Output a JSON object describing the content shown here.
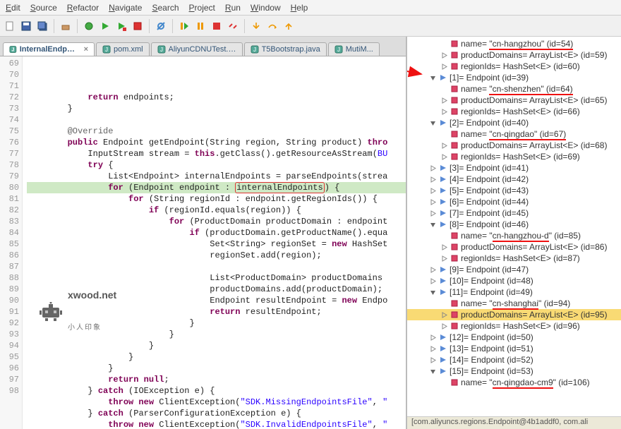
{
  "menu": {
    "items": [
      "Edit",
      "Source",
      "Refactor",
      "Navigate",
      "Search",
      "Project",
      "Run",
      "Window",
      "Help"
    ]
  },
  "tabs": [
    {
      "label": "InternalEndpoin...",
      "active": true
    },
    {
      "label": "pom.xml",
      "active": false
    },
    {
      "label": "AliyunCDNUTest.j...",
      "active": false
    },
    {
      "label": "T5Bootstrap.java",
      "active": false
    },
    {
      "label": "MutiM...",
      "active": false
    }
  ],
  "lines": [
    {
      "n": 69,
      "html": "            <span class='kw'>return</span> endpoints;"
    },
    {
      "n": 70,
      "html": "        }"
    },
    {
      "n": 71,
      "html": ""
    },
    {
      "n": 72,
      "html": "        <span class='ann'>@Override</span>"
    },
    {
      "n": 73,
      "html": "        <span class='kw'>public</span> Endpoint getEndpoint(String region, String product) <span class='kw'>thro</span>"
    },
    {
      "n": 74,
      "html": "            InputStream stream = <span class='kw'>this</span>.getClass().getResourceAsStream(<span class='str'>BU</span>"
    },
    {
      "n": 75,
      "html": "            <span class='kw'>try</span> {"
    },
    {
      "n": 76,
      "html": "                List&lt;Endpoint&gt; internalEndpoints = parseEndpoints(strea"
    },
    {
      "n": 77,
      "html": "<span class='hl-green'>                <span class='kw'>for</span> (Endpoint endpoint : <span class='box-red'>internalEndpoints</span>) {                </span>"
    },
    {
      "n": 78,
      "html": "                    <span class='kw'>for</span> (String regionId : endpoint.getRegionIds()) {"
    },
    {
      "n": 79,
      "html": "                        <span class='kw'>if</span> (regionId.equals(region)) {"
    },
    {
      "n": 80,
      "html": "                            <span class='kw'>for</span> (ProductDomain productDomain : endpoint"
    },
    {
      "n": 81,
      "html": "                                <span class='kw'>if</span> (productDomain.getProductName().equa"
    },
    {
      "n": 82,
      "html": "                                    Set&lt;String&gt; regionSet = <span class='kw'>new</span> HashSet"
    },
    {
      "n": 83,
      "html": "                                    regionSet.add(region);"
    },
    {
      "n": 84,
      "html": ""
    },
    {
      "n": 85,
      "html": "                                    List&lt;ProductDomain&gt; productDomains"
    },
    {
      "n": 86,
      "html": "                                    productDomains.add(productDomain);"
    },
    {
      "n": 87,
      "html": "                                    Endpoint resultEndpoint = <span class='kw'>new</span> Endpo"
    },
    {
      "n": 88,
      "html": "                                    <span class='kw'>return</span> resultEndpoint;"
    },
    {
      "n": 89,
      "html": "                                }"
    },
    {
      "n": 90,
      "html": "                            }"
    },
    {
      "n": 91,
      "html": "                        }"
    },
    {
      "n": 92,
      "html": "                    }"
    },
    {
      "n": 93,
      "html": "                }"
    },
    {
      "n": 94,
      "html": "                <span class='kw'>return null</span>;"
    },
    {
      "n": 95,
      "html": "            } <span class='kw'>catch</span> (IOException e) {"
    },
    {
      "n": 96,
      "html": "                <span class='kw'>throw new</span> ClientException(<span class='str'>\"SDK.MissingEndpointsFile\"</span>, <span class='str'>\"</span>"
    },
    {
      "n": 97,
      "html": "            } <span class='kw'>catch</span> (ParserConfigurationException e) {"
    },
    {
      "n": 98,
      "html": "                <span class='kw'>throw new</span> ClientException(<span class='str'>\"SDK.InvalidEndpointsFile\"</span>, <span class='str'>\"</span>"
    }
  ],
  "watermark": {
    "domain": "xwood.net",
    "sub": "小人印象"
  },
  "tree": [
    {
      "depth": 3,
      "icon": "sq",
      "exp": "",
      "html": "name= <span class='und-red'>\"cn-hangzhou\"  (id=54)</span>"
    },
    {
      "depth": 3,
      "icon": "sq",
      "exp": ">",
      "html": "productDomains= ArrayList&lt;E&gt;  (id=59)"
    },
    {
      "depth": 3,
      "icon": "sq",
      "exp": ">",
      "html": "regionIds= HashSet&lt;E&gt;  (id=60)"
    },
    {
      "depth": 2,
      "icon": "tri",
      "exp": "v",
      "html": "[1]= Endpoint  (id=39)"
    },
    {
      "depth": 3,
      "icon": "sq",
      "exp": "",
      "html": "name= <span class='und-red'>\"cn-shenzhen\"  (id=64)</span>"
    },
    {
      "depth": 3,
      "icon": "sq",
      "exp": ">",
      "html": "productDomains= ArrayList&lt;E&gt;  (id=65)"
    },
    {
      "depth": 3,
      "icon": "sq",
      "exp": ">",
      "html": "regionIds= HashSet&lt;E&gt;  (id=66)"
    },
    {
      "depth": 2,
      "icon": "tri",
      "exp": "v",
      "html": "[2]= Endpoint  (id=40)"
    },
    {
      "depth": 3,
      "icon": "sq",
      "exp": "",
      "html": "name= <span class='und-red'>\"cn-qingdao\"  (id=67)</span>"
    },
    {
      "depth": 3,
      "icon": "sq",
      "exp": ">",
      "html": "productDomains= ArrayList&lt;E&gt;  (id=68)"
    },
    {
      "depth": 3,
      "icon": "sq",
      "exp": ">",
      "html": "regionIds= HashSet&lt;E&gt;  (id=69)"
    },
    {
      "depth": 2,
      "icon": "tri",
      "exp": ">",
      "html": "[3]= Endpoint  (id=41)"
    },
    {
      "depth": 2,
      "icon": "tri",
      "exp": ">",
      "html": "[4]= Endpoint  (id=42)"
    },
    {
      "depth": 2,
      "icon": "tri",
      "exp": ">",
      "html": "[5]= Endpoint  (id=43)"
    },
    {
      "depth": 2,
      "icon": "tri",
      "exp": ">",
      "html": "[6]= Endpoint  (id=44)"
    },
    {
      "depth": 2,
      "icon": "tri",
      "exp": ">",
      "html": "[7]= Endpoint  (id=45)"
    },
    {
      "depth": 2,
      "icon": "tri",
      "exp": "v",
      "html": "[8]= Endpoint  (id=46)"
    },
    {
      "depth": 3,
      "icon": "sq",
      "exp": "",
      "html": "name= \"<span class='und-red'>cn-hangzhou-d</span>\"  (id=85)"
    },
    {
      "depth": 3,
      "icon": "sq",
      "exp": ">",
      "html": "productDomains= ArrayList&lt;E&gt;  (id=86)"
    },
    {
      "depth": 3,
      "icon": "sq",
      "exp": ">",
      "html": "regionIds= HashSet&lt;E&gt;  (id=87)"
    },
    {
      "depth": 2,
      "icon": "tri",
      "exp": ">",
      "html": "[9]= Endpoint  (id=47)"
    },
    {
      "depth": 2,
      "icon": "tri",
      "exp": ">",
      "html": "[10]= Endpoint  (id=48)"
    },
    {
      "depth": 2,
      "icon": "tri",
      "exp": "v",
      "html": "[11]= Endpoint  (id=49)"
    },
    {
      "depth": 3,
      "icon": "sq",
      "exp": "",
      "html": "name= \"<span class='und-red'>cn-shanghai</span>\"  (id=94)"
    },
    {
      "depth": 3,
      "icon": "sq",
      "exp": ">",
      "html": "productDomains= ArrayList&lt;E&gt;  (id=95)",
      "sel": true
    },
    {
      "depth": 3,
      "icon": "sq",
      "exp": ">",
      "html": "regionIds= HashSet&lt;E&gt;  (id=96)"
    },
    {
      "depth": 2,
      "icon": "tri",
      "exp": ">",
      "html": "[12]= Endpoint  (id=50)"
    },
    {
      "depth": 2,
      "icon": "tri",
      "exp": ">",
      "html": "[13]= Endpoint  (id=51)"
    },
    {
      "depth": 2,
      "icon": "tri",
      "exp": ">",
      "html": "[14]= Endpoint  (id=52)"
    },
    {
      "depth": 2,
      "icon": "tri",
      "exp": "v",
      "html": "[15]= Endpoint  (id=53)"
    },
    {
      "depth": 3,
      "icon": "sq",
      "exp": "",
      "html": "name= \"<span class='und-red'>cn-qingdao-cm9</span>\"  (id=106)"
    }
  ],
  "status": "[com.aliyuncs.regions.Endpoint@4b1addf0, com.ali"
}
